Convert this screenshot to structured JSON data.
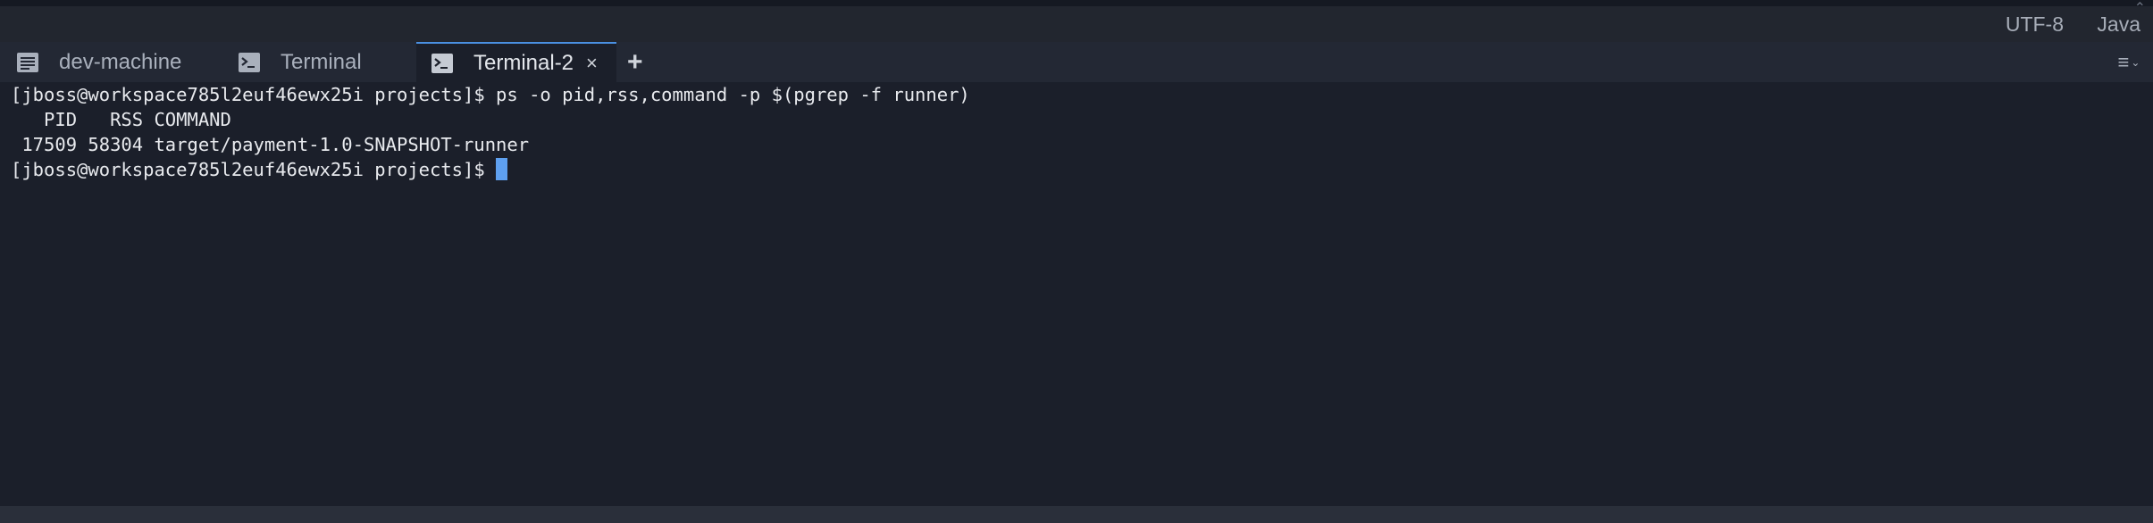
{
  "status_bar": {
    "encoding": "UTF-8",
    "language": "Java"
  },
  "tabs": [
    {
      "label": "dev-machine",
      "icon": "console-list-icon",
      "active": false
    },
    {
      "label": "Terminal",
      "icon": "terminal-icon",
      "active": false
    },
    {
      "label": "Terminal-2",
      "icon": "terminal-icon",
      "active": true,
      "close_symbol": "×"
    }
  ],
  "add_tab_symbol": "+",
  "menu_symbol": "≡",
  "terminal": {
    "lines": [
      "[jboss@workspace785l2euf46ewx25i projects]$ ps -o pid,rss,command -p $(pgrep -f runner)",
      "   PID   RSS COMMAND",
      " 17509 58304 target/payment-1.0-SNAPSHOT-runner",
      "[jboss@workspace785l2euf46ewx25i projects]$"
    ]
  },
  "colors": {
    "background": "#1b1f2a",
    "tab_bar": "#232834",
    "cursor": "#5ea0f0",
    "active_tab_accent": "#4a90e2"
  }
}
